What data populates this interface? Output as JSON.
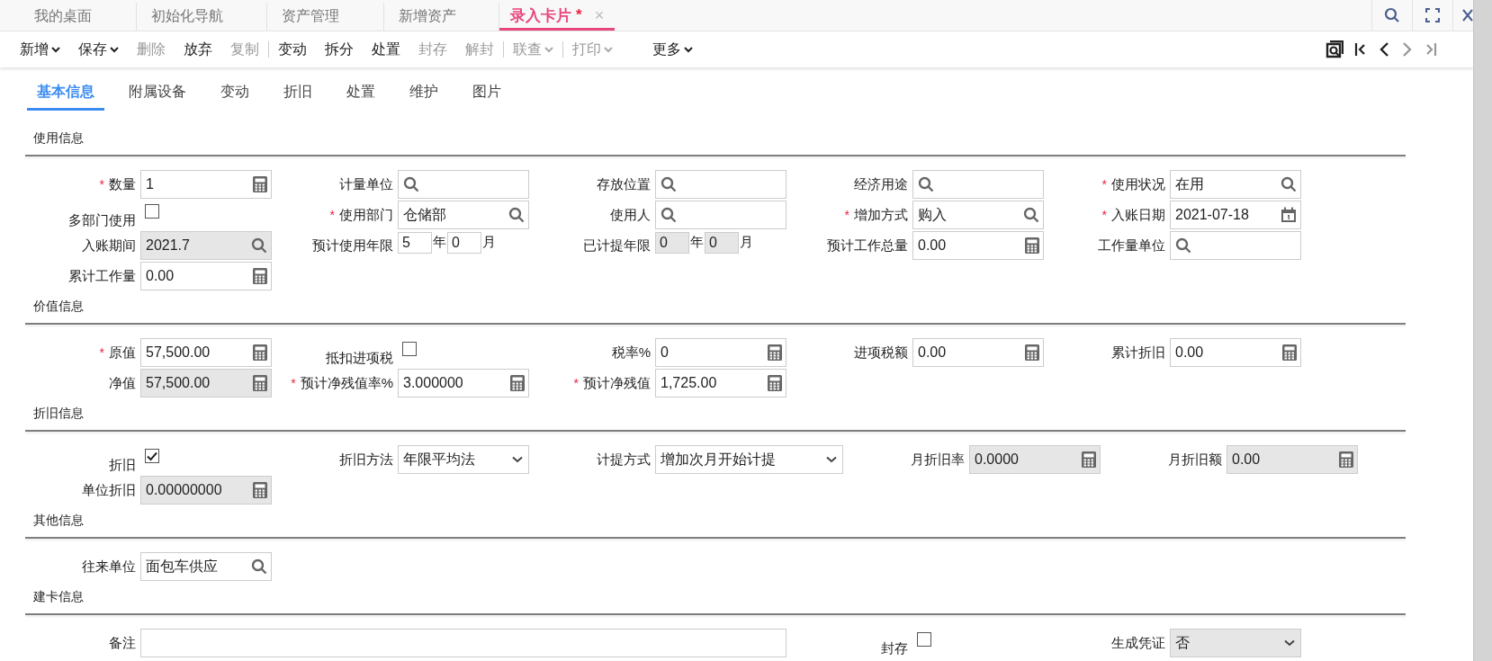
{
  "window_tabs": [
    {
      "label": "我的桌面",
      "selected": false
    },
    {
      "label": "初始化导航",
      "selected": false
    },
    {
      "label": "资产管理",
      "selected": false
    },
    {
      "label": "新增资产",
      "selected": false
    },
    {
      "label": "录入卡片",
      "marker": "*",
      "close": "×",
      "selected": true
    }
  ],
  "toolbar": [
    {
      "label": "新增",
      "dropdown": true,
      "disabled": false
    },
    {
      "label": "保存",
      "dropdown": true,
      "disabled": false
    },
    {
      "label": "删除",
      "disabled": true
    },
    {
      "label": "放弃",
      "disabled": false
    },
    {
      "label": "复制",
      "disabled": true
    },
    {
      "label": "变动",
      "separator_before": true,
      "disabled": false
    },
    {
      "label": "拆分",
      "disabled": false
    },
    {
      "label": "处置",
      "disabled": false
    },
    {
      "label": "封存",
      "disabled": true
    },
    {
      "label": "解封",
      "disabled": true
    },
    {
      "label": "联查",
      "dropdown": true,
      "separator_before": true,
      "disabled": true
    },
    {
      "label": "打印",
      "dropdown": true,
      "separator_before": true,
      "disabled": true
    },
    {
      "label": "更多",
      "dropdown": true,
      "disabled": false
    }
  ],
  "nav_buttons": [
    {
      "kind": "preview",
      "disabled": false
    },
    {
      "kind": "first",
      "disabled": false
    },
    {
      "kind": "prev",
      "disabled": false
    },
    {
      "kind": "next",
      "disabled": true
    },
    {
      "kind": "last",
      "disabled": true
    }
  ],
  "sub_tabs": [
    {
      "label": "基本信息",
      "selected": true
    },
    {
      "label": "附属设备",
      "selected": false
    },
    {
      "label": "变动",
      "selected": false
    },
    {
      "label": "折旧",
      "selected": false
    },
    {
      "label": "处置",
      "selected": false
    },
    {
      "label": "维护",
      "selected": false
    },
    {
      "label": "图片",
      "selected": false
    }
  ],
  "sections": [
    {
      "title": "使用信息",
      "rows": [
        [
          {
            "label": "数量",
            "required_mark": "*",
            "kind": "calc",
            "value": "1",
            "disabled": false
          },
          {
            "label": "计量单位",
            "kind": "lookup",
            "disabled": false
          },
          {
            "label": "存放位置",
            "kind": "lookup",
            "disabled": false
          },
          {
            "label": "经济用途",
            "kind": "lookup",
            "disabled": false
          },
          {
            "label": "使用状况",
            "required_mark": "*",
            "kind": "lookup",
            "value": "在用",
            "disabled": false
          }
        ],
        [
          {
            "label": "多部门使用",
            "kind": "checkbox",
            "checked": false
          },
          {
            "label": "使用部门",
            "required_mark": "*",
            "kind": "lookup",
            "value": "仓储部",
            "disabled": false
          },
          {
            "label": "使用人",
            "kind": "lookup",
            "disabled": false
          },
          {
            "label": "增加方式",
            "required_mark": "*",
            "kind": "lookup",
            "value": "购入",
            "disabled": false
          },
          {
            "label": "入账日期",
            "required_mark": "*",
            "kind": "date",
            "value": "2021-07-18",
            "disabled": false
          }
        ],
        [
          {
            "label": "入账期间",
            "kind": "lookup",
            "value": "2021.7",
            "disabled": true
          },
          {
            "label": "预计使用年限",
            "kind": "yearmonth",
            "years": "5",
            "year_unit": "年",
            "months": "0",
            "month_unit": "月",
            "disabled": false
          },
          {
            "label": "已计提年限",
            "kind": "yearmonth",
            "years": "0",
            "year_unit": "年",
            "months": "0",
            "month_unit": "月",
            "disabled": true
          },
          {
            "label": "预计工作总量",
            "kind": "calc",
            "value": "0.00",
            "disabled": false
          },
          {
            "label": "工作量单位",
            "kind": "lookup",
            "disabled": false
          }
        ],
        [
          {
            "label": "累计工作量",
            "kind": "calc",
            "value": "0.00",
            "disabled": false
          }
        ]
      ]
    },
    {
      "title": "价值信息",
      "rows": [
        [
          {
            "label": "原值",
            "required_mark": "*",
            "kind": "calc",
            "value": "57,500.00",
            "disabled": false
          },
          {
            "label": "抵扣进项税",
            "kind": "checkbox",
            "checked": false
          },
          {
            "label": "税率%",
            "kind": "calc",
            "value": "0",
            "disabled": false
          },
          {
            "label": "进项税额",
            "kind": "calc",
            "value": "0.00",
            "disabled": false
          },
          {
            "label": "累计折旧",
            "kind": "calc",
            "value": "0.00",
            "disabled": false
          }
        ],
        [
          {
            "label": "净值",
            "kind": "calc",
            "value": "57,500.00",
            "disabled": true
          },
          {
            "label": "预计净残值率%",
            "required_mark": "*",
            "kind": "calc",
            "value": "3.000000",
            "disabled": false
          },
          {
            "label": "预计净残值",
            "required_mark": "*",
            "kind": "calc",
            "value": "1,725.00",
            "disabled": false
          }
        ]
      ]
    },
    {
      "title": "折旧信息",
      "rows": [
        [
          {
            "label": "折旧",
            "kind": "checkbox",
            "checked": true
          },
          {
            "label": "折旧方法",
            "kind": "select",
            "value": "年限平均法",
            "disabled": false
          },
          {
            "label": "计提方式",
            "kind": "select",
            "wide": true,
            "value": "增加次月开始计提",
            "disabled": false
          },
          {
            "label": "月折旧率",
            "kind": "calc",
            "value": "0.0000",
            "disabled": true
          },
          {
            "label": "月折旧额",
            "kind": "calc",
            "value": "0.00",
            "disabled": true
          }
        ],
        [
          {
            "label": "单位折旧",
            "kind": "calc",
            "value": "0.00000000",
            "disabled": true
          }
        ]
      ]
    },
    {
      "title": "其他信息",
      "rows": [
        [
          {
            "label": "往来单位",
            "kind": "lookup",
            "value": "面包车供应",
            "disabled": false
          }
        ]
      ]
    },
    {
      "title": "建卡信息",
      "rows": [
        [
          {
            "label": "备注",
            "kind": "text",
            "full_width": true,
            "disabled": false
          },
          {
            "label": "封存",
            "kind": "checkbox",
            "checked": false
          },
          {
            "label": "生成凭证",
            "kind": "select",
            "value": "否",
            "disabled": true
          }
        ]
      ]
    }
  ]
}
